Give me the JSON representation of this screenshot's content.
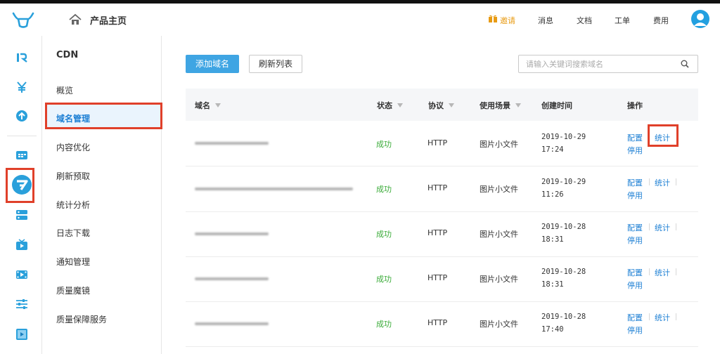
{
  "header": {
    "home_title": "产品主页",
    "nav": [
      "邀请",
      "消息",
      "文档",
      "工单",
      "费用"
    ]
  },
  "menu": {
    "title": "CDN",
    "items": [
      "概览",
      "域名管理",
      "内容优化",
      "刷新预取",
      "统计分析",
      "日志下载",
      "通知管理",
      "质量魔镜",
      "质量保障服务"
    ]
  },
  "toolbar": {
    "add_label": "添加域名",
    "refresh_label": "刷新列表",
    "search_placeholder": "请输入关键词搜索域名"
  },
  "table": {
    "headers": {
      "domain": "域名",
      "status": "状态",
      "protocol": "协议",
      "scenario": "使用场景",
      "created": "创建时间",
      "actions": "操作"
    },
    "rows": [
      {
        "status": "成功",
        "protocol": "HTTP",
        "scenario": "图片小文件",
        "date": "2019-10-29",
        "time": "17:24"
      },
      {
        "status": "成功",
        "protocol": "HTTP",
        "scenario": "图片小文件",
        "date": "2019-10-29",
        "time": "11:26"
      },
      {
        "status": "成功",
        "protocol": "HTTP",
        "scenario": "图片小文件",
        "date": "2019-10-28",
        "time": "18:31"
      },
      {
        "status": "成功",
        "protocol": "HTTP",
        "scenario": "图片小文件",
        "date": "2019-10-28",
        "time": "18:31"
      },
      {
        "status": "成功",
        "protocol": "HTTP",
        "scenario": "图片小文件",
        "date": "2019-10-28",
        "time": "17:40"
      }
    ],
    "action_labels": {
      "config": "配置",
      "stats": "统计",
      "disable": "停用"
    }
  },
  "colors": {
    "accent": "#3fa5e3",
    "success": "#3aab38",
    "highlight": "#e0402a",
    "invite": "#e89b13"
  }
}
